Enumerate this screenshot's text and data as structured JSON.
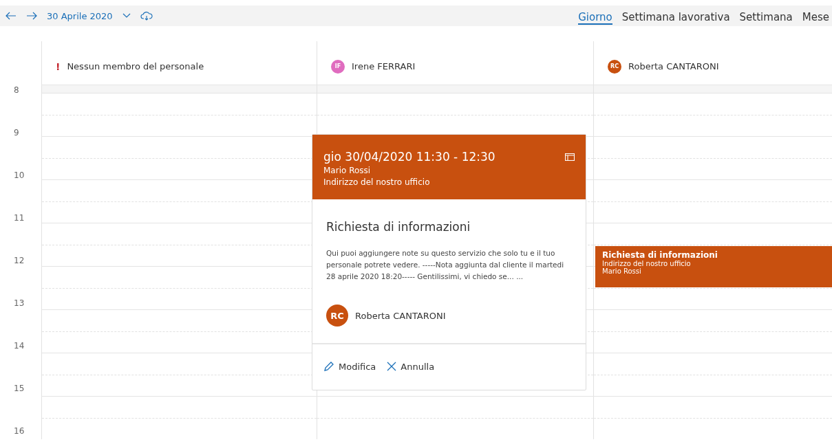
{
  "toolbar": {
    "date": "30 Aprile 2020",
    "views": [
      {
        "label": "Giorno",
        "selected": true
      },
      {
        "label": "Settimana lavorativa",
        "selected": false
      },
      {
        "label": "Settimana",
        "selected": false
      },
      {
        "label": "Mese",
        "selected": false
      }
    ]
  },
  "staff": [
    {
      "kind": "warning",
      "marker": "!",
      "name": "Nessun membro del personale"
    },
    {
      "kind": "person",
      "initials": "IF",
      "color": "#e06cbf",
      "name": "Irene FERRARI"
    },
    {
      "kind": "person",
      "initials": "RC",
      "color": "#c8500f",
      "name": "Roberta CANTARONI",
      "events": [
        {
          "title": "Richiesta di informazioni",
          "location": "Indirizzo del nostro ufficio",
          "customer": "Mario Rossi"
        }
      ]
    }
  ],
  "hours": [
    "8",
    "9",
    "10",
    "11",
    "12",
    "13",
    "14",
    "15",
    "16"
  ],
  "popup": {
    "when": "gio 30/04/2020 11:30 - 12:30",
    "customer": "Mario Rossi",
    "location": "Indirizzo del nostro ufficio",
    "title": "Richiesta di informazioni",
    "notes": "Qui puoi aggiungere note su questo servizio che solo tu e il tuo personale potrete vedere. -----Nota aggiunta dal cliente il martedi 28 aprile 2020 18:20----- Gentilissimi, vi chiedo se... ...",
    "staff": {
      "initials": "RC",
      "name": "Roberta CANTARONI",
      "color": "#c8500f"
    },
    "actions": [
      {
        "kind": "edit",
        "label": "Modifica"
      },
      {
        "kind": "cancel",
        "label": "Annulla"
      }
    ]
  }
}
